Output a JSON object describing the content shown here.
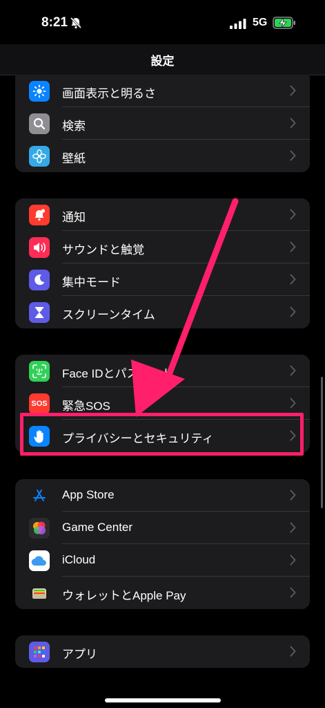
{
  "status": {
    "time": "8:21",
    "network": "5G"
  },
  "nav": {
    "title": "設定"
  },
  "groups": [
    {
      "items": [
        {
          "label": "画面表示と明るさ",
          "icon": "brightness-icon",
          "color": "#0a84ff"
        },
        {
          "label": "検索",
          "icon": "search-icon",
          "color": "#8e8e93"
        },
        {
          "label": "壁紙",
          "icon": "wallpaper-flower-icon",
          "color": "#35a9e6"
        }
      ]
    },
    {
      "items": [
        {
          "label": "通知",
          "icon": "notification-bell-icon",
          "color": "#ff3b30"
        },
        {
          "label": "サウンドと触覚",
          "icon": "speaker-icon",
          "color": "#ff2d55"
        },
        {
          "label": "集中モード",
          "icon": "moon-icon",
          "color": "#5e5ce6"
        },
        {
          "label": "スクリーンタイム",
          "icon": "hourglass-icon",
          "color": "#5e5ce6"
        }
      ]
    },
    {
      "items": [
        {
          "label": "Face IDとパスコード",
          "icon": "face-id-icon",
          "color": "#30d158"
        },
        {
          "label": "緊急SOS",
          "icon": "sos-icon",
          "color": "#ff3b30",
          "text": "SOS"
        },
        {
          "label": "プライバシーとセキュリティ",
          "icon": "privacy-hand-icon",
          "color": "#0a84ff"
        }
      ]
    },
    {
      "items": [
        {
          "label": "App Store",
          "icon": "app-store-icon",
          "color": "#0a84ff"
        },
        {
          "label": "Game Center",
          "icon": "game-center-icon",
          "color": "#2c2c2e"
        },
        {
          "label": "iCloud",
          "icon": "icloud-icon",
          "color": "#ffffff"
        },
        {
          "label": "ウォレットとApple Pay",
          "icon": "wallet-icon",
          "color": "#1c1c1e"
        }
      ]
    },
    {
      "items": [
        {
          "label": "アプリ",
          "icon": "apps-grid-icon",
          "color": "#5e5ce6"
        }
      ]
    }
  ],
  "annotation": {
    "color": "#ff1f6b"
  }
}
